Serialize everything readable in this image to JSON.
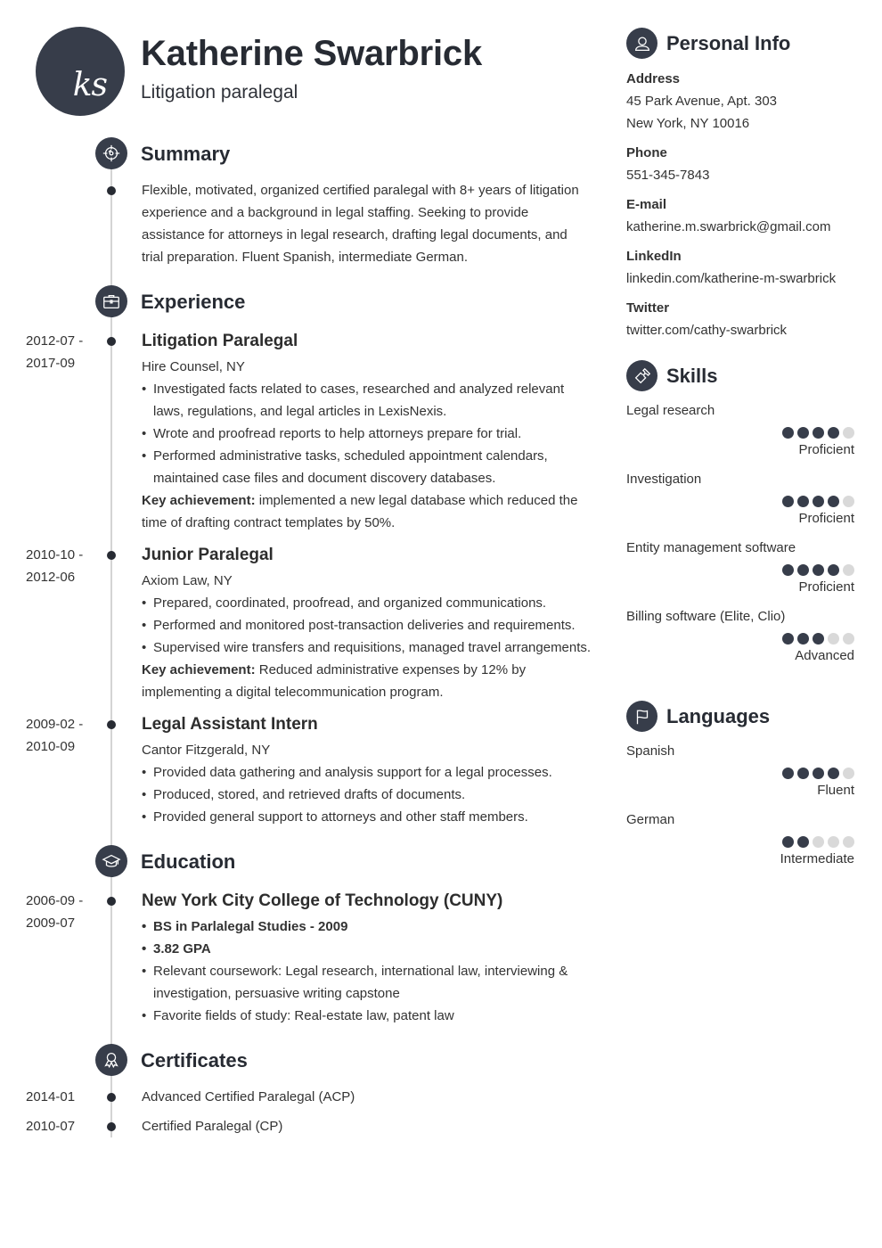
{
  "header": {
    "initials": "ks",
    "name": "Katherine Swarbrick",
    "title": "Litigation paralegal"
  },
  "colors": {
    "accent": "#373d4a",
    "timeline": "#d4d4d4",
    "rating_empty": "#d9d9d9"
  },
  "summary": {
    "heading": "Summary",
    "icon": "target-icon",
    "text": "Flexible, motivated, organized certified paralegal with 8+ years of litigation experience and a background in legal staffing. Seeking to provide assistance for attorneys in legal research, drafting legal documents, and trial preparation. Fluent Spanish, intermediate German."
  },
  "experience": {
    "heading": "Experience",
    "icon": "briefcase-icon",
    "items": [
      {
        "date_start": "2012-07 -",
        "date_end": "2017-09",
        "title": "Litigation Paralegal",
        "company": "Hire Counsel, NY",
        "bullets": [
          "Investigated facts related to cases, researched and analyzed relevant laws, regulations, and legal articles in LexisNexis.",
          "Wrote and proofread reports to help attorneys prepare for trial.",
          "Performed administrative tasks, scheduled appointment calendars, maintained case files and document discovery databases."
        ],
        "achievement_label": "Key achievement:",
        "achievement_text": " implemented a new legal database which reduced the time of drafting contract templates by 50%."
      },
      {
        "date_start": "2010-10 -",
        "date_end": "2012-06",
        "title": "Junior Paralegal",
        "company": "Axiom Law, NY",
        "bullets": [
          "Prepared, coordinated, proofread, and organized communications.",
          "Performed and monitored post-transaction deliveries and requirements.",
          "Supervised wire transfers and requisitions, managed travel arrangements."
        ],
        "achievement_label": "Key achievement:",
        "achievement_text": " Reduced administrative expenses by 12% by implementing a digital telecommunication program."
      },
      {
        "date_start": "2009-02 -",
        "date_end": "2010-09",
        "title": "Legal Assistant Intern",
        "company": "Cantor Fitzgerald, NY",
        "bullets": [
          "Provided data gathering and analysis support for a legal processes.",
          "Produced, stored, and retrieved drafts of documents.",
          "Provided general support to attorneys and other staff members."
        ]
      }
    ]
  },
  "education": {
    "heading": "Education",
    "icon": "graduation-cap-icon",
    "items": [
      {
        "date_start": "2006-09 -",
        "date_end": "2009-07",
        "school": "New York City College of Technology (CUNY)",
        "bold_bullets": [
          "BS in Parlalegal Studies - 2009",
          "3.82 GPA"
        ],
        "bullets": [
          "Relevant coursework: Legal research, international law, interviewing & investigation, persuasive writing capstone",
          "Favorite fields of study: Real-estate law, patent law"
        ]
      }
    ]
  },
  "certificates": {
    "heading": "Certificates",
    "icon": "award-ribbon-icon",
    "items": [
      {
        "date": "2014-01",
        "name": "Advanced Certified Paralegal (ACP)"
      },
      {
        "date": "2010-07",
        "name": "Certified Paralegal (CP)"
      }
    ]
  },
  "personal_info": {
    "heading": "Personal Info",
    "icon": "user-icon",
    "address_label": "Address",
    "address_line1": "45 Park Avenue, Apt. 303",
    "address_line2": "New York, NY 10016",
    "phone_label": "Phone",
    "phone": "551-345-7843",
    "email_label": "E-mail",
    "email": "katherine.m.swarbrick@gmail.com",
    "linkedin_label": "LinkedIn",
    "linkedin": "linkedin.com/katherine-m-swarbrick",
    "twitter_label": "Twitter",
    "twitter": "twitter.com/cathy-swarbrick"
  },
  "skills": {
    "heading": "Skills",
    "icon": "puzzle-piece-icon",
    "max": 5,
    "items": [
      {
        "name": "Legal research",
        "rating": 4,
        "level": "Proficient"
      },
      {
        "name": "Investigation",
        "rating": 4,
        "level": "Proficient"
      },
      {
        "name": "Entity management software",
        "rating": 4,
        "level": "Proficient"
      },
      {
        "name": "Billing software (Elite, Clio)",
        "rating": 3,
        "level": "Advanced"
      }
    ]
  },
  "languages": {
    "heading": "Languages",
    "icon": "flag-icon",
    "max": 5,
    "items": [
      {
        "name": "Spanish",
        "rating": 4,
        "level": "Fluent"
      },
      {
        "name": "German",
        "rating": 2,
        "level": "Intermediate"
      }
    ]
  }
}
